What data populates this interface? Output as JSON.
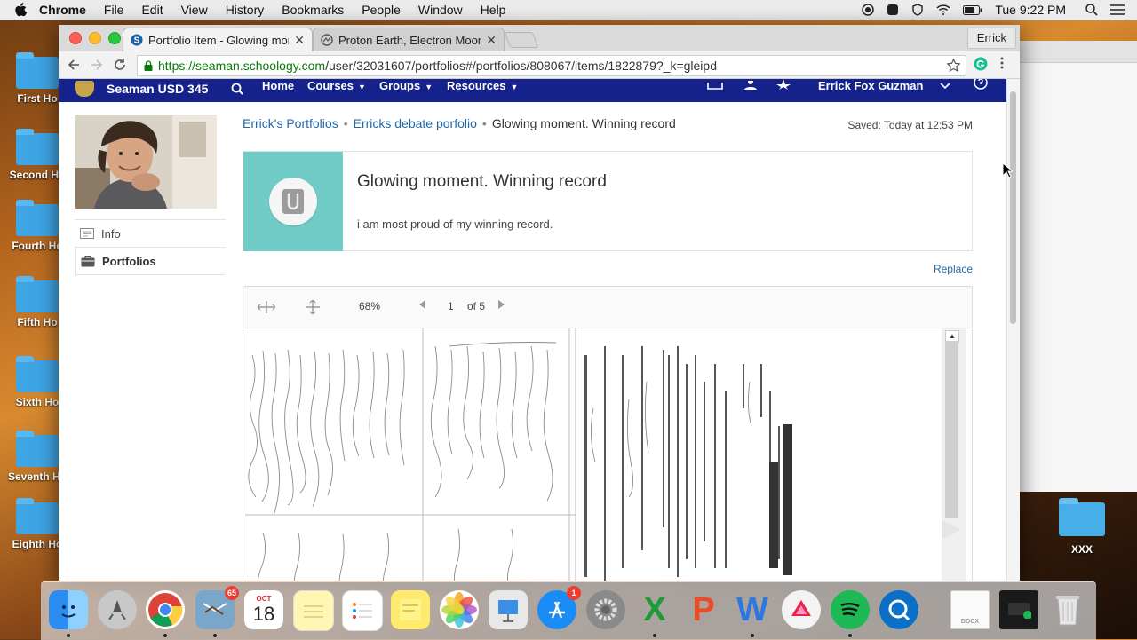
{
  "menubar": {
    "app": "Chrome",
    "items": [
      "File",
      "Edit",
      "View",
      "History",
      "Bookmarks",
      "People",
      "Window",
      "Help"
    ],
    "clock": "Tue 9:22 PM"
  },
  "desktop": {
    "folders": [
      "First Ho",
      "Second Ho",
      "Fourth Ho",
      "Fifth Ho",
      "Sixth Ho",
      "Seventh Ho",
      "Eighth Ho"
    ],
    "right_folder": "XXX"
  },
  "browser": {
    "tabs": [
      {
        "title": "Portfolio Item - Glowing mome",
        "active": true
      },
      {
        "title": "Proton Earth, Electron Moon",
        "active": false
      }
    ],
    "profile": "Errick",
    "url_secure": "https://seaman.schoology.com",
    "url_rest": "/user/32031607/portfolios#/portfolios/808067/items/1822879?_k=gleipd"
  },
  "site": {
    "logo": "Seaman USD 345",
    "nav": [
      {
        "label": "Home",
        "has_caret": false
      },
      {
        "label": "Courses",
        "has_caret": true
      },
      {
        "label": "Groups",
        "has_caret": true
      },
      {
        "label": "Resources",
        "has_caret": true
      }
    ],
    "user_name": "Errick Fox Guzman"
  },
  "sidebar": {
    "items": [
      {
        "label": "Info",
        "icon": "id-card-icon",
        "active": false
      },
      {
        "label": "Portfolios",
        "icon": "briefcase-icon",
        "active": true
      }
    ]
  },
  "breadcrumb": {
    "items": [
      "Errick's Portfolios",
      "Erricks debate porfolio"
    ],
    "current": "Glowing moment. Winning record"
  },
  "saved": "Saved: Today at 12:53 PM",
  "item": {
    "title": "Glowing moment. Winning record",
    "description": "i am most proud of my winning record.",
    "thumb_color": "#71ccc7"
  },
  "replace": "Replace",
  "viewer": {
    "zoom": "68%",
    "page": "1",
    "of_pages": "of 5"
  },
  "dock": {
    "mail_badge": "65",
    "calendar_month": "OCT",
    "calendar_day": "18",
    "appstore_badge": "1"
  },
  "colors": {
    "navbar": "#16228b",
    "link": "#2268a8"
  }
}
